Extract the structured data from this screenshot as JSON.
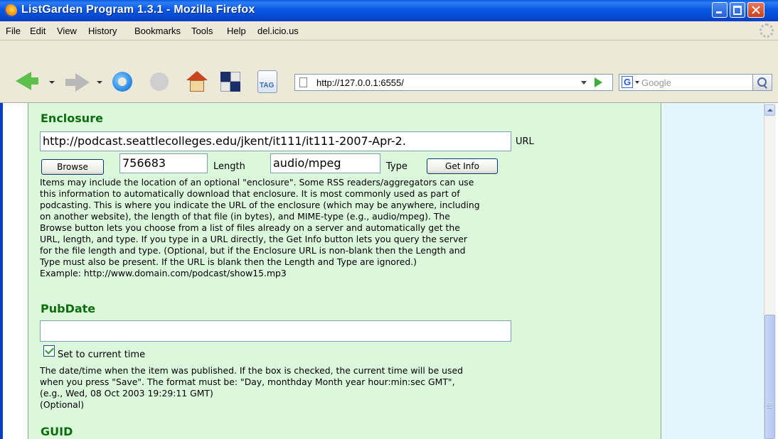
{
  "window": {
    "title": "ListGarden Program 1.3.1 - Mozilla Firefox"
  },
  "menu": {
    "items": [
      "File",
      "Edit",
      "View",
      "History",
      "Bookmarks",
      "Tools",
      "Help",
      "del.icio.us"
    ]
  },
  "toolbar": {
    "tag_label": "TAG",
    "url": "http://127.0.0.1:6555/",
    "search_engine_letter": "G",
    "search_placeholder": "Google"
  },
  "enclosure": {
    "heading": "Enclosure",
    "url_value": "http://podcast.seattlecolleges.edu/jkent/it111/it111-2007-Apr-2.",
    "url_label": "URL",
    "browse_button": "Browse",
    "length_value": "756683",
    "length_label": "Length",
    "type_value": "audio/mpeg",
    "type_label": "Type",
    "get_info_button": "Get Info",
    "help": "Items may include the location of an optional \"enclosure\". Some RSS readers/aggregators can use\nthis information to automatically download that enclosure. It is most commonly used as part of\npodcasting. This is where you indicate the URL of the enclosure (which may be anywhere, including\non another website), the length of that file (in bytes), and MIME-type (e.g., audio/mpeg). The\nBrowse button lets you choose from a list of files already on a server and automatically get the\nURL, length, and type. If you type in a URL directly, the Get Info button lets you query the server\nfor the file length and type. (Optional, but if the Enclosure URL is non-blank then the Length and\nType must also be present. If the URL is blank then the Length and Type are ignored.)\nExample: http://www.domain.com/podcast/show15.mp3"
  },
  "pubdate": {
    "heading": "PubDate",
    "value": "",
    "checkbox_checked": true,
    "checkbox_label": "Set to current time",
    "help": "The date/time when the item was published. If the box is checked, the current time will be used\nwhen you press \"Save\". The format must be: \"Day, monthday Month year hour:min:sec GMT\",\n(e.g., Wed, 08 Oct 2003 19:29:11 GMT)\n(Optional)"
  },
  "guid": {
    "heading": "GUID"
  }
}
